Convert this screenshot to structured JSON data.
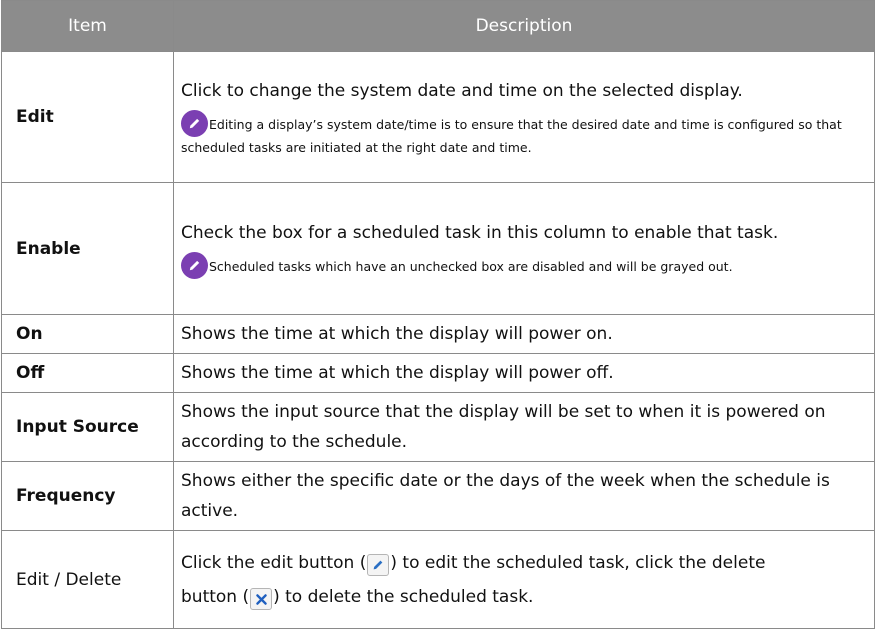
{
  "header": {
    "col_item": "Item",
    "col_description": "Description"
  },
  "rows": [
    {
      "item": "Edit",
      "description": "Click to change the system date and time on the selected display.",
      "note": "Editing a display’s system date/time is to ensure that the desired date and time is configured so that scheduled tasks are initiated at the right date and time.",
      "note_icon": "pencil-note-icon"
    },
    {
      "item": "Enable",
      "description": "Check the box for a scheduled task in this column to enable that task.",
      "note": "Scheduled tasks which have an unchecked box are disabled and will be grayed out.",
      "note_icon": "pencil-note-icon"
    },
    {
      "item": "On",
      "description": "Shows the time at which the display will power on."
    },
    {
      "item": "Off",
      "description": "Shows the time at which the display will power off."
    },
    {
      "item": "Input Source",
      "description": "Shows the input source that the display will be set to when it is powered on according to the schedule."
    },
    {
      "item": "Frequency",
      "description": "Shows either the specific date or the days of the week when the schedule is active."
    },
    {
      "item": "Edit / Delete",
      "desc_part1": "Click the edit button (",
      "desc_part2": ") to edit the scheduled task, click the delete",
      "desc_part3": "button (",
      "desc_part4": ") to delete the scheduled task.",
      "edit_icon": "pencil-icon",
      "delete_icon": "close-icon"
    }
  ],
  "colors": {
    "header_bg": "#8c8c8c",
    "border": "#8a8a8a",
    "note_icon": "#7b3fb2",
    "pencil_blue": "#2a6fc4",
    "delete_blue": "#1f5fbf"
  }
}
